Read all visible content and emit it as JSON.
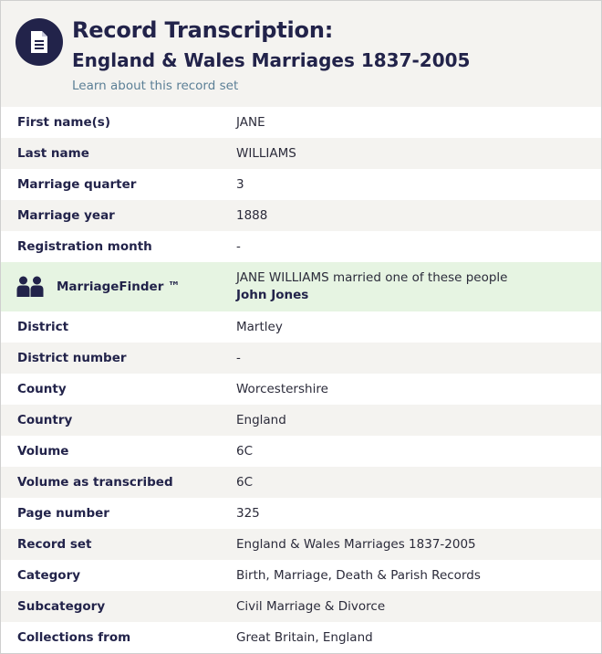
{
  "header": {
    "title": "Record Transcription:",
    "subtitle": "England & Wales Marriages 1837-2005",
    "learn_link": "Learn about this record set",
    "icon": "document-icon"
  },
  "rows_before_finder": [
    {
      "label": "First name(s)",
      "value": "JANE"
    },
    {
      "label": "Last name",
      "value": "WILLIAMS"
    },
    {
      "label": "Marriage quarter",
      "value": "3"
    },
    {
      "label": "Marriage year",
      "value": "1888"
    },
    {
      "label": "Registration month",
      "value": "-"
    }
  ],
  "marriage_finder": {
    "label": "MarriageFinder ™",
    "text": "JANE WILLIAMS married one of these people",
    "spouse": "John Jones",
    "icon": "people-icon"
  },
  "rows_after_finder": [
    {
      "label": "District",
      "value": "Martley"
    },
    {
      "label": "District number",
      "value": "-"
    },
    {
      "label": "County",
      "value": "Worcestershire"
    },
    {
      "label": "Country",
      "value": "England"
    },
    {
      "label": "Volume",
      "value": "6C"
    },
    {
      "label": "Volume as transcribed",
      "value": "6C"
    },
    {
      "label": "Page number",
      "value": "325"
    },
    {
      "label": "Record set",
      "value": "England & Wales Marriages 1837-2005"
    },
    {
      "label": "Category",
      "value": "Birth, Marriage, Death & Parish Records"
    },
    {
      "label": "Subcategory",
      "value": "Civil Marriage & Divorce"
    },
    {
      "label": "Collections from",
      "value": "Great Britain, England"
    }
  ],
  "colors": {
    "navy": "#22234a",
    "row_alt": "#f4f3f0",
    "finder_bg": "#e6f4e2",
    "link": "#5b7f96"
  }
}
